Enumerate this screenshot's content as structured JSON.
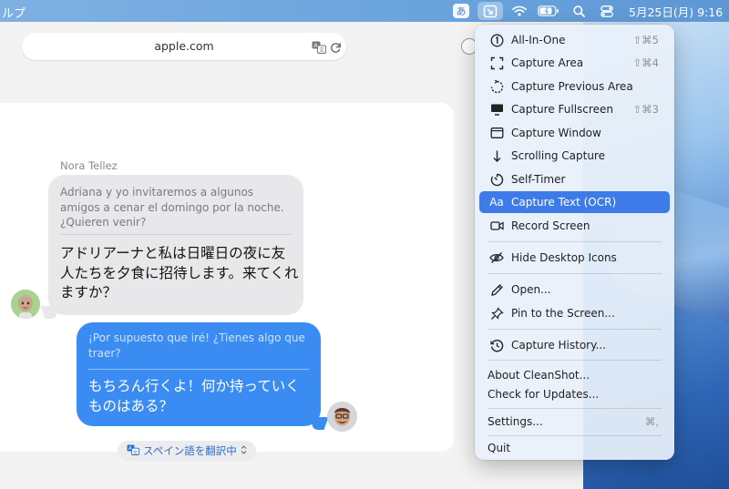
{
  "menubar": {
    "app_menu": "ルプ",
    "input_method": "あ",
    "clock": "5月25日(月) 9:16"
  },
  "browser": {
    "url": "apple.com"
  },
  "conversation": {
    "sender": "Nora Tellez",
    "incoming": {
      "original": "Adriana y yo invitaremos a algunos amigos a cenar el domingo por la noche. ¿Quieren venir?",
      "translated": "アドリアーナと私は日曜日の夜に友人たちを夕食に招待します。来てくれますか？"
    },
    "outgoing": {
      "original": "¡Por supuesto que iré! ¿Tienes algo que traer?",
      "translated": "もちろん行くよ！何か持っていくものはある？"
    },
    "translate_pill": "スペイン語を翻訳中"
  },
  "menu": {
    "items": [
      {
        "label": "All-In-One",
        "shortcut": "⇧⌘5",
        "icon": "circle-1-icon"
      },
      {
        "label": "Capture Area",
        "shortcut": "⇧⌘4",
        "icon": "area-icon"
      },
      {
        "label": "Capture Previous Area",
        "shortcut": "",
        "icon": "previous-area-icon"
      },
      {
        "label": "Capture Fullscreen",
        "shortcut": "⇧⌘3",
        "icon": "monitor-icon"
      },
      {
        "label": "Capture Window",
        "shortcut": "",
        "icon": "window-icon"
      },
      {
        "label": "Scrolling Capture",
        "shortcut": "",
        "icon": "arrow-down-icon"
      },
      {
        "label": "Self-Timer",
        "shortcut": "",
        "icon": "timer-icon"
      },
      {
        "label": "Capture Text (OCR)",
        "shortcut": "",
        "icon": "text-aa-icon",
        "selected": true
      },
      {
        "label": "Record Screen",
        "shortcut": "",
        "icon": "video-camera-icon"
      },
      {
        "label": "Hide Desktop Icons",
        "shortcut": "",
        "icon": "eye-slash-icon"
      },
      {
        "label": "Open...",
        "shortcut": "",
        "icon": "pencil-icon"
      },
      {
        "label": "Pin to the Screen...",
        "shortcut": "",
        "icon": "pin-icon"
      },
      {
        "label": "Capture History...",
        "shortcut": "",
        "icon": "history-icon"
      },
      {
        "label": "About CleanShot...",
        "shortcut": ""
      },
      {
        "label": "Check for Updates...",
        "shortcut": ""
      },
      {
        "label": "Settings...",
        "shortcut": "⌘,"
      },
      {
        "label": "Quit",
        "shortcut": ""
      }
    ]
  },
  "colors": {
    "accent": "#3c7be8",
    "bubble_outgoing": "#3b8cf2",
    "bubble_incoming": "#e8e8ea"
  }
}
